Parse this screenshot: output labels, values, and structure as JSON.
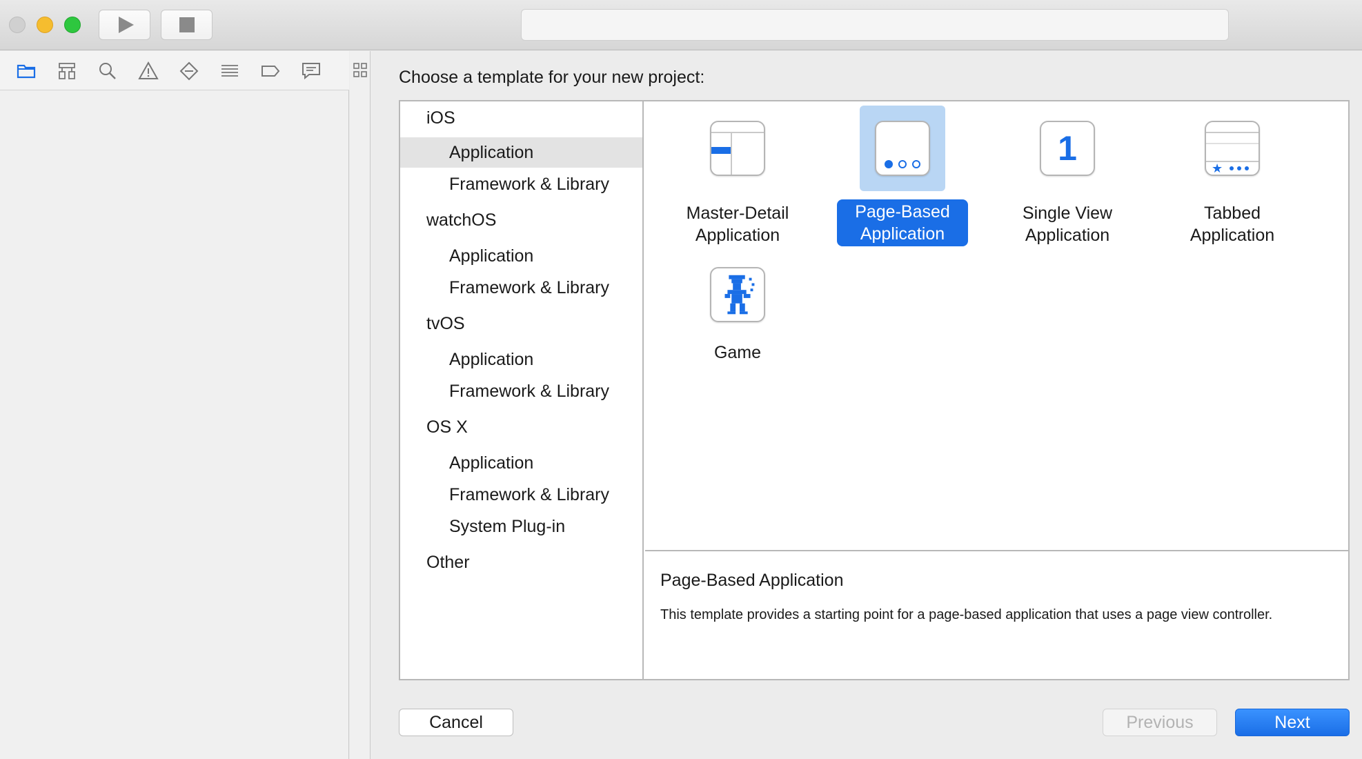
{
  "toolbar": {
    "run_icon": "play-icon",
    "stop_icon": "stop-icon",
    "activity_text": ""
  },
  "navigator": {
    "tabs": [
      "folder-icon",
      "hierarchy-icon",
      "search-icon",
      "warning-icon",
      "diamond-icon",
      "list-icon",
      "tag-icon",
      "comment-icon"
    ],
    "accent": "#1a6ee6"
  },
  "sheet": {
    "title": "Choose a template for your new project:",
    "platforms": [
      {
        "label": "iOS",
        "kind": "head"
      },
      {
        "label": "Application",
        "kind": "sub",
        "selected": true
      },
      {
        "label": "Framework & Library",
        "kind": "sub"
      },
      {
        "label": "watchOS",
        "kind": "head"
      },
      {
        "label": "Application",
        "kind": "sub"
      },
      {
        "label": "Framework & Library",
        "kind": "sub"
      },
      {
        "label": "tvOS",
        "kind": "head"
      },
      {
        "label": "Application",
        "kind": "sub"
      },
      {
        "label": "Framework & Library",
        "kind": "sub"
      },
      {
        "label": "OS X",
        "kind": "head"
      },
      {
        "label": "Application",
        "kind": "sub"
      },
      {
        "label": "Framework & Library",
        "kind": "sub"
      },
      {
        "label": "System Plug-in",
        "kind": "sub"
      },
      {
        "label": "Other",
        "kind": "head"
      }
    ],
    "templates": [
      {
        "line1": "Master-Detail",
        "line2": "Application",
        "icon": "master-detail-icon"
      },
      {
        "line1": "Page-Based",
        "line2": "Application",
        "icon": "page-based-icon",
        "selected": true
      },
      {
        "line1": "Single View",
        "line2": "Application",
        "icon": "single-view-icon",
        "glyph": "1"
      },
      {
        "line1": "Tabbed",
        "line2": "Application",
        "icon": "tabbed-icon"
      },
      {
        "line1": "Game",
        "line2": "",
        "icon": "game-icon"
      }
    ],
    "description": {
      "title": "Page-Based Application",
      "text": "This template provides a starting point for a page-based application that uses a page view controller."
    },
    "buttons": {
      "cancel": "Cancel",
      "previous": "Previous",
      "next": "Next"
    }
  }
}
